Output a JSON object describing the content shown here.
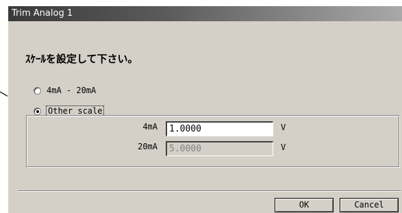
{
  "window": {
    "title": "Trim Analog 1"
  },
  "instruction": "ｽｹｰﾙを設定して下さい。",
  "options": [
    {
      "label": "4mA - 20mA",
      "selected": false
    },
    {
      "label": "Other scale",
      "selected": true
    }
  ],
  "fields": [
    {
      "label": "4mA",
      "value": "1.0000",
      "unit": "V",
      "enabled": true
    },
    {
      "label": "20mA",
      "value": "5.0000",
      "unit": "V",
      "enabled": false
    }
  ],
  "buttons": {
    "ok": "OK",
    "cancel": "Cancel"
  },
  "colors": {
    "face": "#d4d0c8",
    "title_dark": "#3a3a3a"
  }
}
